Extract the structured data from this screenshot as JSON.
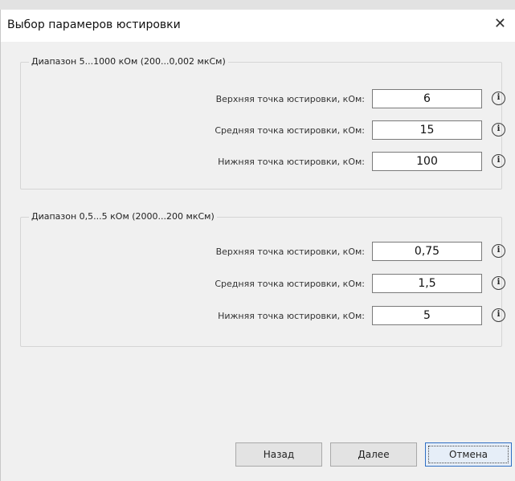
{
  "dialog": {
    "title": "Выбор парамеров юстировки"
  },
  "group1": {
    "legend": "Диапазон 5...1000 кОм (200...0,002 мкСм)",
    "rows": [
      {
        "label": "Верхняя точка юстировки, кОм:",
        "value": "6"
      },
      {
        "label": "Средняя точка юстировки, кОм:",
        "value": "15"
      },
      {
        "label": "Нижняя точка юстировки, кОм:",
        "value": "100"
      }
    ]
  },
  "group2": {
    "legend": "Диапазон 0,5...5 кОм (2000...200 мкСм)",
    "rows": [
      {
        "label": "Верхняя точка юстировки, кОм:",
        "value": "0,75"
      },
      {
        "label": "Средняя точка юстировки, кОм:",
        "value": "1,5"
      },
      {
        "label": "Нижняя точка юстировки, кОм:",
        "value": "5"
      }
    ]
  },
  "buttons": {
    "back": "Назад",
    "next": "Далее",
    "cancel": "Отмена"
  },
  "icons": {
    "close": "close-icon",
    "info": "info-icon"
  },
  "colors": {
    "window_bg": "#f0f0f0",
    "titlebar_bg": "#ffffff",
    "primary_border": "#2f6fc4"
  }
}
